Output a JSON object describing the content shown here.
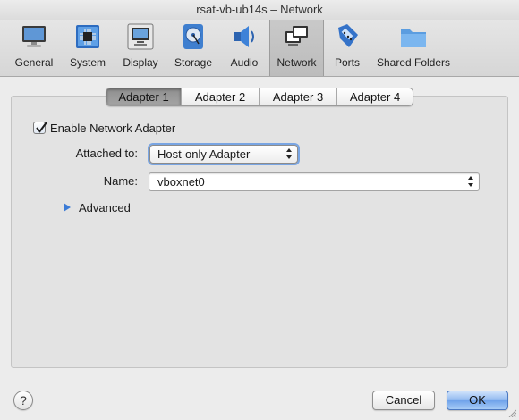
{
  "window": {
    "title": "rsat-vb-ub14s – Network"
  },
  "toolbar": {
    "items": [
      {
        "label": "General",
        "icon": "monitor-icon"
      },
      {
        "label": "System",
        "icon": "chip-icon"
      },
      {
        "label": "Display",
        "icon": "display-icon"
      },
      {
        "label": "Storage",
        "icon": "disk-icon"
      },
      {
        "label": "Audio",
        "icon": "speaker-icon"
      },
      {
        "label": "Network",
        "icon": "network-icon",
        "active": true
      },
      {
        "label": "Ports",
        "icon": "ports-icon"
      },
      {
        "label": "Shared Folders",
        "icon": "folder-icon"
      }
    ]
  },
  "tabs": [
    {
      "label": "Adapter 1",
      "active": true
    },
    {
      "label": "Adapter 2"
    },
    {
      "label": "Adapter 3"
    },
    {
      "label": "Adapter 4"
    }
  ],
  "adapter": {
    "enable_label": "Enable Network Adapter",
    "enabled": true,
    "attached_label": "Attached to:",
    "attached_value": "Host-only Adapter",
    "name_label": "Name:",
    "name_value": "vboxnet0",
    "advanced_label": "Advanced"
  },
  "footer": {
    "help_label": "?",
    "cancel_label": "Cancel",
    "ok_label": "OK"
  },
  "colors": {
    "accent": "#6fa2ea",
    "focus_ring": "#79a5e3"
  }
}
